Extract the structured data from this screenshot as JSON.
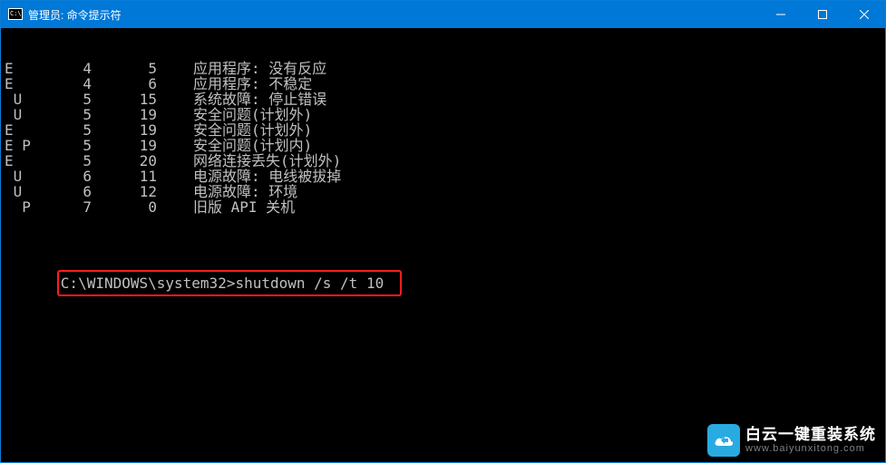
{
  "titlebar": {
    "icon": "cmd-icon",
    "title": "管理员: 命令提示符"
  },
  "terminal": {
    "rows": [
      {
        "c0": "E",
        "c1": "4",
        "c2": "5",
        "desc": "应用程序: 没有反应"
      },
      {
        "c0": "E",
        "c1": "4",
        "c2": "6",
        "desc": "应用程序: 不稳定"
      },
      {
        "c0": " U",
        "c1": "5",
        "c2": "15",
        "desc": "系统故障: 停止错误"
      },
      {
        "c0": " U",
        "c1": "5",
        "c2": "19",
        "desc": "安全问题(计划外)"
      },
      {
        "c0": "E",
        "c1": "5",
        "c2": "19",
        "desc": "安全问题(计划外)"
      },
      {
        "c0": "E P",
        "c1": "5",
        "c2": "19",
        "desc": "安全问题(计划内)"
      },
      {
        "c0": "E",
        "c1": "5",
        "c2": "20",
        "desc": "网络连接丢失(计划外)"
      },
      {
        "c0": " U",
        "c1": "6",
        "c2": "11",
        "desc": "电源故障: 电线被拔掉"
      },
      {
        "c0": " U",
        "c1": "6",
        "c2": "12",
        "desc": "电源故障: 环境"
      },
      {
        "c0": "  P",
        "c1": "7",
        "c2": "0",
        "desc": "旧版 API 关机"
      }
    ],
    "prompt": "C:\\WINDOWS\\system32>",
    "command": "shutdown /s /t 10"
  },
  "watermark": {
    "line1": "白云一键重装系统",
    "line2": "www.baiyunxitong.com"
  }
}
